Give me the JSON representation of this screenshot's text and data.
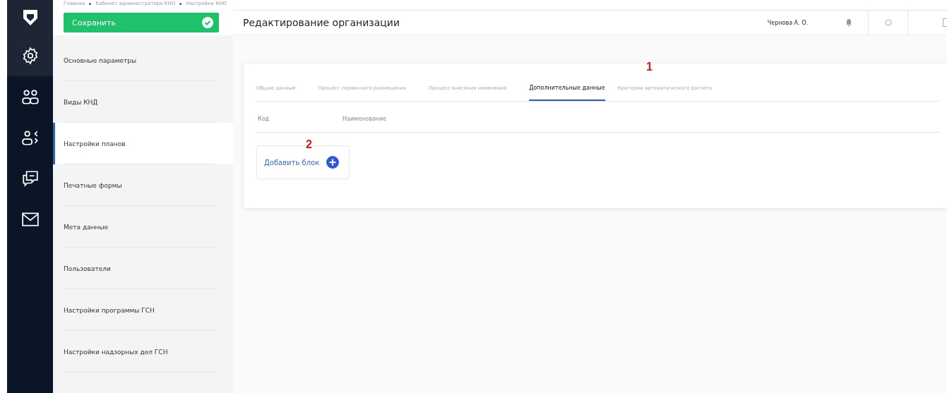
{
  "breadcrumbs": [
    "Главная",
    "Кабинет администратора КНО",
    "Настройки КНО"
  ],
  "save_button": {
    "label": "Сохранить"
  },
  "page_title": "Редактирование организации",
  "user": {
    "name": "Чернова А. О."
  },
  "rail": [
    {
      "kind": "gear",
      "selected": true
    },
    {
      "kind": "people",
      "selected": false
    },
    {
      "kind": "exchange",
      "selected": false
    },
    {
      "kind": "chat",
      "selected": false
    },
    {
      "kind": "mail",
      "selected": false
    }
  ],
  "sidebar": {
    "items": [
      {
        "label": "Основные параметры",
        "selected": false
      },
      {
        "label": "Виды КНД",
        "selected": false
      },
      {
        "label": "Настройки планов",
        "selected": true
      },
      {
        "label": "Печатные формы",
        "selected": false
      },
      {
        "label": "Мета данные",
        "selected": false
      },
      {
        "label": "Пользователи",
        "selected": false
      },
      {
        "label": "Настройки программы ГСН",
        "selected": false
      },
      {
        "label": "Настройки надзорных дел ГСН",
        "selected": false
      }
    ]
  },
  "tabs": [
    {
      "label": "Общие данные",
      "selected": false
    },
    {
      "label": "Процесс первичного размещения",
      "selected": false
    },
    {
      "label": "Процесс внесения изменений",
      "selected": false
    },
    {
      "label": "Дополнительные данные",
      "selected": true
    },
    {
      "label": "Критерии автоматического расчета",
      "selected": false
    }
  ],
  "table": {
    "columns": [
      "Код",
      "Наименование"
    ]
  },
  "add_block_button": {
    "label": "Добавить блок"
  },
  "callouts": [
    "1",
    "2"
  ]
}
